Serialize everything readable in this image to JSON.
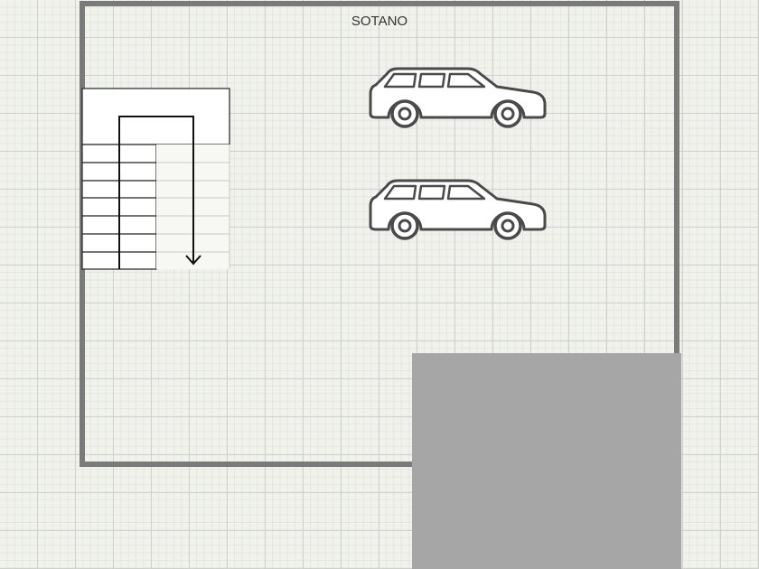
{
  "room": {
    "label": "SOTANO"
  },
  "colors": {
    "wall": "#7a7a7a",
    "block": "#a6a6a6",
    "stroke": "#4a4a4a",
    "car_fill": "#ffffff"
  },
  "stair": {
    "steps": 7,
    "direction": "down"
  },
  "cars": 2
}
